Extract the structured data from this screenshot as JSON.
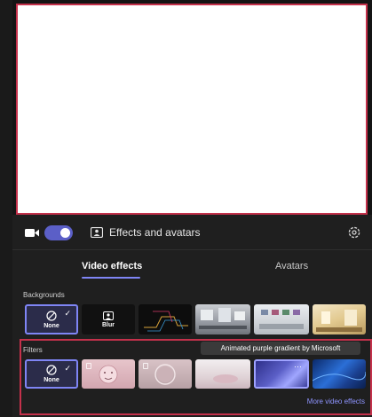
{
  "header": {
    "effects_label": "Effects and avatars"
  },
  "tabs": [
    {
      "label": "Video effects",
      "active": true
    },
    {
      "label": "Avatars",
      "active": false
    }
  ],
  "backgrounds": {
    "label": "Backgrounds",
    "none_label": "None",
    "blur_label": "Blur"
  },
  "filters": {
    "label": "Filters",
    "none_label": "None",
    "tooltip": "Animated purple gradient by Microsoft",
    "more_link": "More video effects"
  },
  "camera": {
    "enabled": true
  },
  "colors": {
    "accent": "#5b5fc7",
    "highlight_border": "#c4314b",
    "link": "#8e94ff"
  }
}
